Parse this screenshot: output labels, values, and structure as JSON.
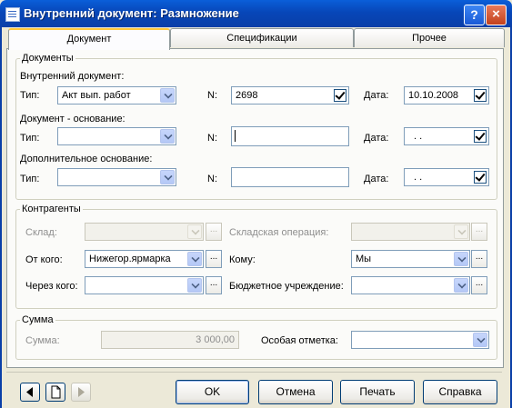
{
  "window": {
    "title": "Внутренний документ: Размножение",
    "help_label": "?",
    "close_label": "×"
  },
  "tabs": [
    {
      "label": "Документ"
    },
    {
      "label": "Спецификации"
    },
    {
      "label": "Прочее"
    }
  ],
  "documents": {
    "legend": "Документы",
    "internal_label": "Внутренний документ:",
    "type_label": "Тип:",
    "type_value": "Акт вып. работ",
    "n_label": "N:",
    "n_value": "2698",
    "date_label": "Дата:",
    "date_value": "10.10.2008",
    "basis_label": "Документ - основание:",
    "basis_type_label": "Тип:",
    "basis_n_label": "N:",
    "basis_date_label": "Дата:",
    "basis_date_value": ". .",
    "extra_label": "Дополнительное основание:",
    "extra_type_label": "Тип:",
    "extra_n_label": "N:",
    "extra_date_label": "Дата:",
    "extra_date_value": ". ."
  },
  "contractors": {
    "legend": "Контрагенты",
    "warehouse_label": "Склад:",
    "warehouse_op_label": "Складская операция:",
    "from_label": "От кого:",
    "from_value": "Нижегор.ярмарка",
    "to_label": "Кому:",
    "to_value": "Мы",
    "via_label": "Через кого:",
    "budget_label": "Бюджетное учреждение:",
    "ellipsis": "..."
  },
  "sum": {
    "legend": "Сумма",
    "sum_label": "Сумма:",
    "sum_value": "3 000,00",
    "special_label": "Особая отметка:"
  },
  "buttons": {
    "ok": "OK",
    "cancel": "Отмена",
    "print": "Печать",
    "help": "Справка"
  },
  "colors": {
    "title_bar": "#0a5fd9",
    "window_bg": "#ece9d8",
    "active_tab_accent": "#ffc83c",
    "field_border": "#7f9db9"
  }
}
